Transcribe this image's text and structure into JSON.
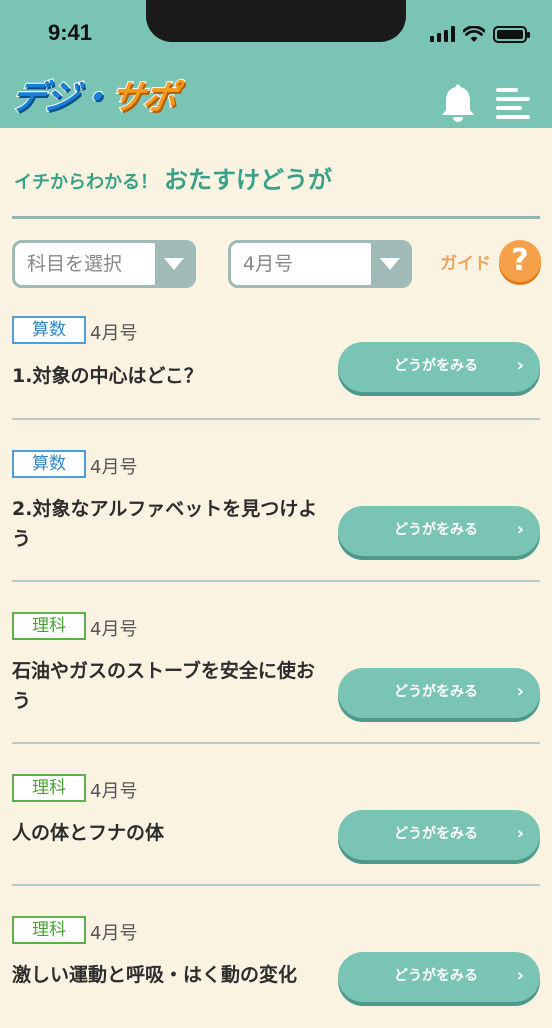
{
  "status": {
    "time": "9:41"
  },
  "header": {
    "logo_part1": "デジ・",
    "logo_part2": "サポ"
  },
  "section": {
    "subtitle": "イチからわかる！",
    "title": "おたすけどうが"
  },
  "filters": {
    "subject": {
      "value": "科目を選択"
    },
    "issue": {
      "value": "4月号"
    },
    "guide_label": "ガイド",
    "guide_icon": "?"
  },
  "videos": [
    {
      "subject": "算数",
      "issue": "4月号",
      "title": "1.対象の中心はどこ？",
      "button": "どうがをみる"
    },
    {
      "subject": "算数",
      "issue": "4月号",
      "title": "2.対象なアルファベットを見つけよう",
      "button": "どうがをみる"
    },
    {
      "subject": "理科",
      "issue": "4月号",
      "title": "石油やガスのストーブを安全に使おう",
      "button": "どうがをみる"
    },
    {
      "subject": "理科",
      "issue": "4月号",
      "title": "人の体とフナの体",
      "button": "どうがをみる"
    },
    {
      "subject": "理科",
      "issue": "4月号",
      "title": "激しい運動と呼吸・はく動の変化",
      "button": "どうがをみる"
    }
  ],
  "colors": {
    "header": "#79c4b4",
    "background": "#fbf3e2",
    "accent_text": "#3aa189",
    "math_tag": "#2f86c8",
    "science_tag": "#48a236",
    "guide": "#f7a04a"
  },
  "icons": [
    "bell-icon",
    "menu-icon",
    "chevron-down-icon",
    "chevron-right-icon",
    "question-icon"
  ]
}
